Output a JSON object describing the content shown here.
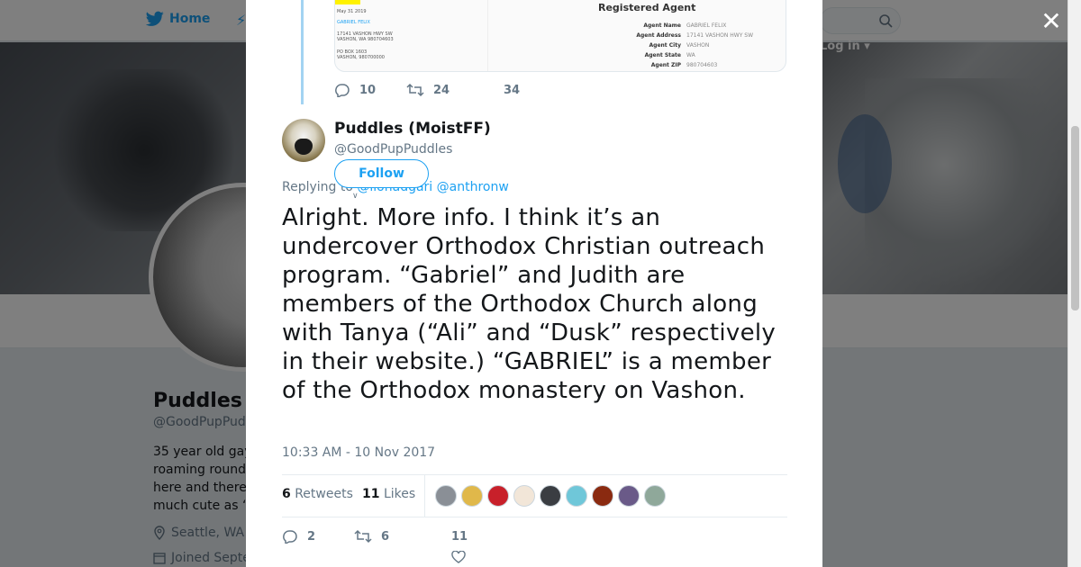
{
  "nav": {
    "home_label": "Home",
    "login_label": "Log in ▾"
  },
  "profile": {
    "name": "Puddles",
    "handle": "@GoodPupPud",
    "bio": "35 year old gay roaming round here and there much cute as “",
    "location": "Seattle, WA",
    "joined": "Joined Septe"
  },
  "previous_tweet": {
    "card_title": "Registered Agent",
    "card_left_lines": [
      "May 31 2019",
      "GABRIEL FELIX",
      "17141 VASHON HWY SW",
      "VASHON, WA 980704603",
      "PO BOX 1603",
      "VASHON, 980700000"
    ],
    "card_rows": [
      {
        "key": "Agent Name",
        "value": "GABRIEL FELIX"
      },
      {
        "key": "Agent Address",
        "value": "17141 VASHON HWY SW"
      },
      {
        "key": "Agent City",
        "value": "VASHON"
      },
      {
        "key": "Agent State",
        "value": "WA"
      },
      {
        "key": "Agent ZIP",
        "value": "980704603"
      }
    ],
    "replies": "10",
    "retweets": "24",
    "likes": "34"
  },
  "tweet": {
    "author_name": "Puddles (MoistFF)",
    "author_handle": "@GoodPupPuddles",
    "follow_label": "Follow",
    "replying_prefix": "Replying to",
    "replying_to": "@lionadgari @anthronw",
    "text": "Alright. More info. I think it’s an undercover Orthodox Christian outreach program. “Gabriel” and Judith are members of the Orthodox Church along with Tanya (“Ali” and “Dusk” respectively in their website.) “GABRIEL” is a member of the Orthodox monastery on Vashon.",
    "timestamp": "10:33 AM - 10 Nov 2017",
    "retweet_count": "6",
    "retweet_label": "Retweets",
    "like_count": "11",
    "like_label": "Likes",
    "replies": "2",
    "retweets": "6",
    "likes": "11"
  },
  "colors": {
    "accent": "#1da1f2",
    "text": "#14171a",
    "muted": "#657786"
  }
}
